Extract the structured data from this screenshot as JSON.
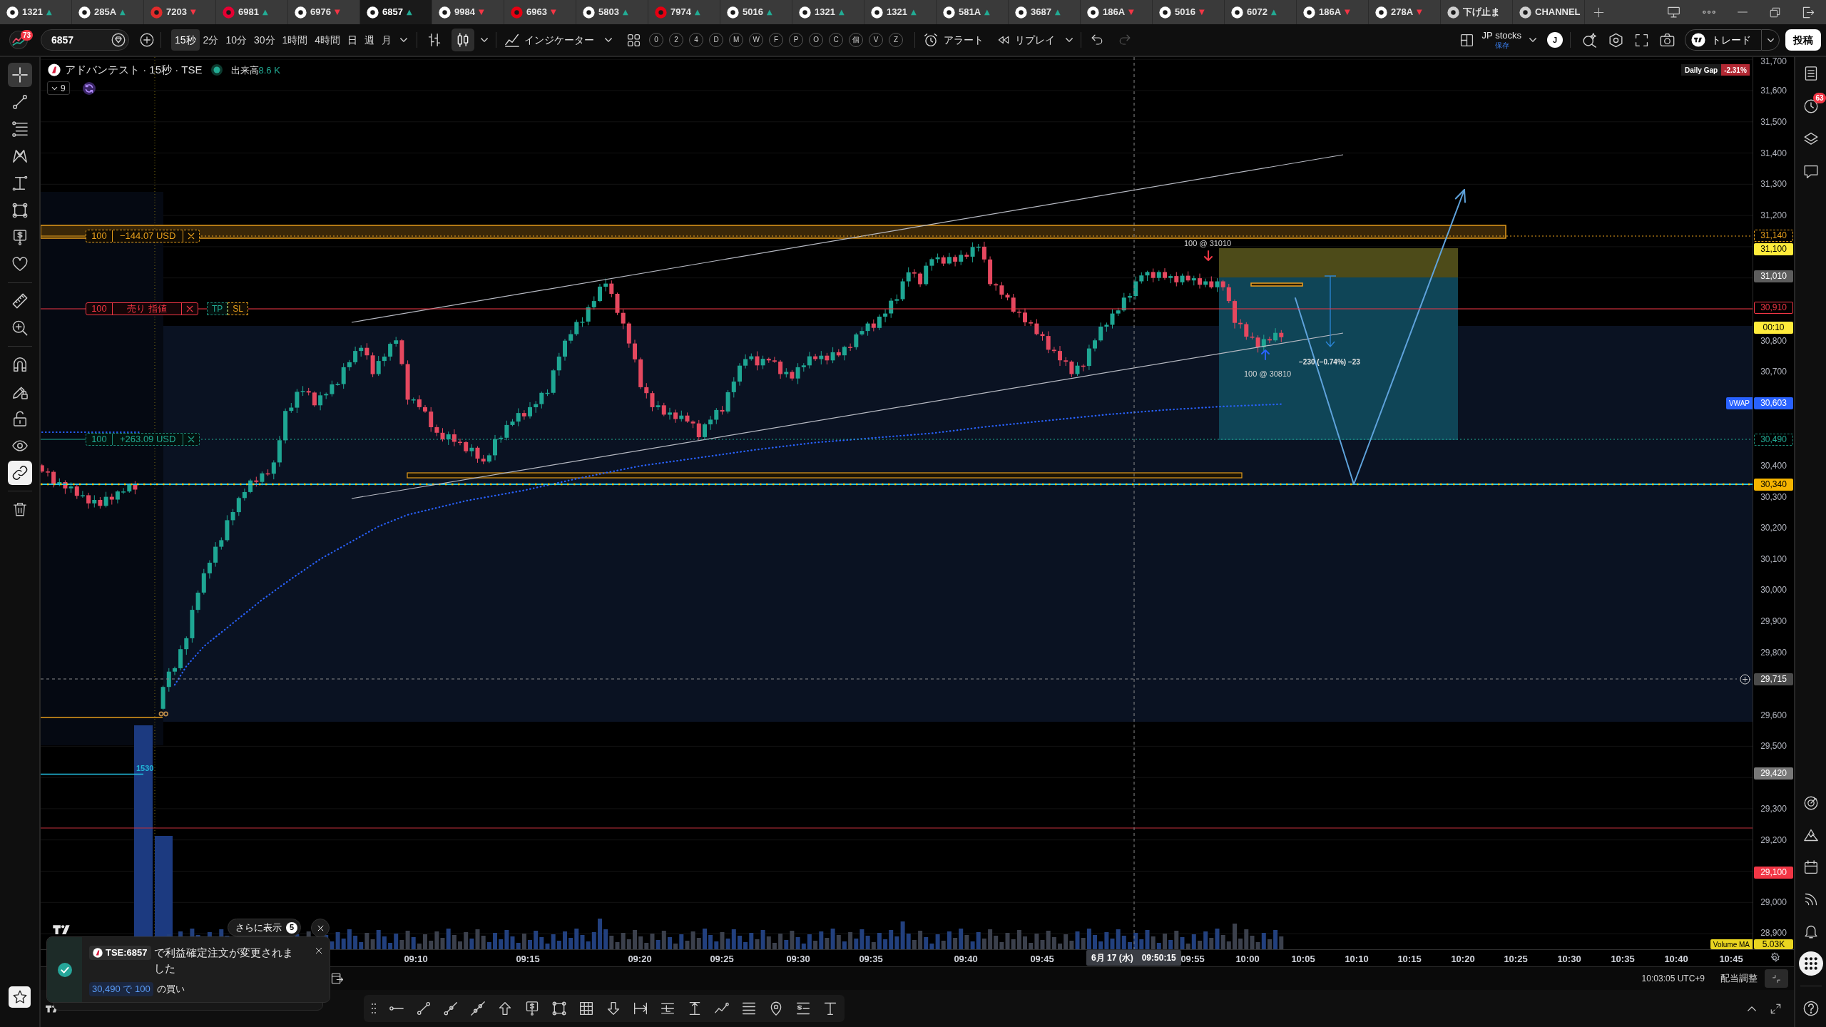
{
  "tabs": [
    {
      "symbol": "1321",
      "arrow": "▲",
      "color": "#22ab94",
      "selected": false
    },
    {
      "symbol": "285A",
      "arrow": "▲",
      "color": "#22ab94",
      "selected": false
    },
    {
      "symbol": "7203",
      "arrow": "▼",
      "color": "#f23645",
      "selected": false
    },
    {
      "symbol": "6981",
      "arrow": "▲",
      "color": "#22ab94",
      "selected": false
    },
    {
      "symbol": "6976",
      "arrow": "▼",
      "color": "#f23645",
      "selected": false
    },
    {
      "symbol": "6857",
      "arrow": "▲",
      "color": "#22ab94",
      "selected": true
    },
    {
      "symbol": "9984",
      "arrow": "▼",
      "color": "#f23645",
      "selected": false
    },
    {
      "symbol": "6963",
      "arrow": "▼",
      "color": "#f23645",
      "selected": false
    },
    {
      "symbol": "5803",
      "arrow": "▲",
      "color": "#22ab94",
      "selected": false
    },
    {
      "symbol": "7974",
      "arrow": "▲",
      "color": "#22ab94",
      "selected": false
    },
    {
      "symbol": "5016",
      "arrow": "▲",
      "color": "#22ab94",
      "selected": false
    },
    {
      "symbol": "1321",
      "arrow": "▲",
      "color": "#22ab94",
      "selected": false
    },
    {
      "symbol": "1321",
      "arrow": "▲",
      "color": "#22ab94",
      "selected": false
    },
    {
      "symbol": "581A",
      "arrow": "▲",
      "color": "#22ab94",
      "selected": false
    },
    {
      "symbol": "3687",
      "arrow": "▲",
      "color": "#22ab94",
      "selected": false
    },
    {
      "symbol": "186A",
      "arrow": "▼",
      "color": "#f23645",
      "selected": false
    },
    {
      "symbol": "5016",
      "arrow": "▼",
      "color": "#f23645",
      "selected": false
    },
    {
      "symbol": "6072",
      "arrow": "▲",
      "color": "#22ab94",
      "selected": false
    },
    {
      "symbol": "186A",
      "arrow": "▼",
      "color": "#f23645",
      "selected": false
    },
    {
      "symbol": "278A",
      "arrow": "▼",
      "color": "#f23645",
      "selected": false
    },
    {
      "symbol": "下げ止ま",
      "selected": false
    },
    {
      "symbol": "CHANNEL",
      "selected": false
    }
  ],
  "toolbar": {
    "profile_badge": "73",
    "symbol_search": {
      "value": "6857"
    },
    "intervals": [
      {
        "label": "15秒",
        "selected": true
      },
      {
        "label": "2分",
        "selected": false
      },
      {
        "label": "10分",
        "selected": false
      },
      {
        "label": "30分",
        "selected": false
      },
      {
        "label": "1時間",
        "selected": false
      },
      {
        "label": "4時間",
        "selected": false
      },
      {
        "label": "日",
        "selected": false
      },
      {
        "label": "週",
        "selected": false
      },
      {
        "label": "月",
        "selected": false
      }
    ],
    "chart_types": [
      {
        "kind": "bars",
        "selected": false
      },
      {
        "kind": "candles",
        "selected": true
      }
    ],
    "indicators_label": "インジケーター",
    "indicator_shortcuts": [
      "0",
      "2",
      "4",
      "D",
      "M",
      "W",
      "F",
      "P",
      "O",
      "C",
      "個",
      "V",
      "Z"
    ],
    "alert_label": "アラート",
    "replay_label": "リプレイ",
    "undo_disabled": false,
    "redo_disabled": true,
    "layout": {
      "name": "JP stocks",
      "status": "保存"
    },
    "user_initial": "J",
    "trade_label": "トレード",
    "publish_label": "投稿"
  },
  "left_toolbar": {
    "drawing_tools": [
      {
        "kind": "crosshair",
        "selected": true
      },
      {
        "kind": "trend_line",
        "selected": false
      },
      {
        "kind": "fib_lines",
        "selected": false
      },
      {
        "kind": "pattern",
        "selected": false
      },
      {
        "kind": "projection",
        "selected": false
      },
      {
        "kind": "rectangle",
        "selected": false
      },
      {
        "kind": "price_label",
        "selected": false
      },
      {
        "kind": "favorites",
        "selected": false
      }
    ],
    "measure_tools": [
      {
        "kind": "ruler",
        "selected": false
      },
      {
        "kind": "zoom",
        "selected": false
      }
    ],
    "toggles": [
      {
        "kind": "magnet",
        "on": false
      },
      {
        "kind": "drawing_lock",
        "on": false
      },
      {
        "kind": "lock",
        "on": false
      },
      {
        "kind": "visibility",
        "on": false
      },
      {
        "kind": "sync",
        "on": true
      }
    ]
  },
  "chart": {
    "legend": {
      "title": "アドバンテスト · 15秒 · TSE",
      "market_open": true,
      "volume_label": "出来高",
      "volume_value": "8.6 K",
      "indicator_count": "9"
    },
    "daily_gap": {
      "label": "Daily Gap",
      "value": "-2.31%"
    },
    "order_lines": [
      {
        "kind": "stop_loss",
        "quantity": "100",
        "text": "−144.07 USD"
      },
      {
        "kind": "limit_order",
        "quantity": "100",
        "text": "売り 指値",
        "brackets": [
          {
            "kind": "take_profit",
            "label": "TP"
          },
          {
            "kind": "stop_loss",
            "label": "SL"
          }
        ]
      },
      {
        "kind": "take_profit",
        "quantity": "100",
        "text": "+263.09 USD"
      }
    ],
    "trade_markers": [
      {
        "kind": "sell",
        "text": "100 @ 31010"
      },
      {
        "kind": "buy",
        "text": "100 @ 30810"
      }
    ],
    "measurement": "−230 (−0.74%) −23",
    "level_note": "1530"
  },
  "price_axis": {
    "labels": [
      {
        "text": "31,700",
        "kind": "tick"
      },
      {
        "text": "31,600",
        "kind": "tick"
      },
      {
        "text": "31,500",
        "kind": "tick"
      },
      {
        "text": "31,400",
        "kind": "tick"
      },
      {
        "text": "31,300",
        "kind": "tick"
      },
      {
        "text": "31,200",
        "kind": "tick"
      },
      {
        "text": "31,140",
        "kind": "stop_loss"
      },
      {
        "text": "31,100",
        "kind": "highlight"
      },
      {
        "text": "31,010",
        "kind": "last_price"
      },
      {
        "text": "30,910",
        "kind": "order"
      },
      {
        "text": "00:10",
        "kind": "countdown"
      },
      {
        "text": "30,800",
        "kind": "tick"
      },
      {
        "text": "30,700",
        "kind": "tick"
      },
      {
        "text": "30,603",
        "kind": "vwap",
        "tag": "VWAP"
      },
      {
        "text": "30,490",
        "kind": "take_profit"
      },
      {
        "text": "30,400",
        "kind": "tick"
      },
      {
        "text": "30,340",
        "kind": "line"
      },
      {
        "text": "30,300",
        "kind": "tick"
      },
      {
        "text": "30,200",
        "kind": "tick"
      },
      {
        "text": "30,100",
        "kind": "tick"
      },
      {
        "text": "30,000",
        "kind": "tick"
      },
      {
        "text": "29,900",
        "kind": "tick"
      },
      {
        "text": "29,800",
        "kind": "tick"
      },
      {
        "text": "29,715",
        "kind": "crosshair"
      },
      {
        "text": "29,600",
        "kind": "tick"
      },
      {
        "text": "29,500",
        "kind": "tick"
      },
      {
        "text": "29,420",
        "kind": "marker"
      },
      {
        "text": "29,300",
        "kind": "tick"
      },
      {
        "text": "29,200",
        "kind": "tick"
      },
      {
        "text": "29,100",
        "kind": "alert"
      },
      {
        "text": "29,000",
        "kind": "tick"
      },
      {
        "text": "28,900",
        "kind": "tick"
      },
      {
        "text": "5.03K",
        "kind": "volume_ma",
        "tag": "Volume MA"
      }
    ]
  },
  "time_axis": {
    "labels": [
      "09:10",
      "09:15",
      "09:20",
      "09:25",
      "09:30",
      "09:35",
      "09:40",
      "09:45",
      "09:55",
      "10:00",
      "10:05",
      "10:10",
      "10:15",
      "10:20",
      "10:25",
      "10:30",
      "10:35",
      "10:40",
      "10:45"
    ],
    "crosshair": {
      "date": "6月 17 (水)",
      "time": "09:50:15"
    }
  },
  "status_bar": {
    "clock": "10:03:05 UTC+9",
    "adjustment": "配当調整"
  },
  "right_sidebar": {
    "top_items": [
      {
        "kind": "watchlist",
        "selected": false
      },
      {
        "kind": "alerts",
        "badge": "63",
        "selected": false
      },
      {
        "kind": "layers",
        "selected": false
      },
      {
        "kind": "chat",
        "selected": false
      }
    ],
    "bottom_items": [
      {
        "kind": "target",
        "selected": false
      },
      {
        "kind": "ideas",
        "selected": false
      },
      {
        "kind": "calendar",
        "selected": false
      },
      {
        "kind": "signals",
        "selected": false
      },
      {
        "kind": "notifications",
        "selected": false
      },
      {
        "kind": "apps",
        "selected": true
      },
      {
        "kind": "help",
        "selected": false
      }
    ]
  },
  "notification": {
    "more_label": "さらに表示",
    "more_count": "5",
    "symbol": "TSE:6857",
    "message": "で利益確定注文が変更されました",
    "order": "30,490 で 100",
    "action": "の買い"
  }
}
